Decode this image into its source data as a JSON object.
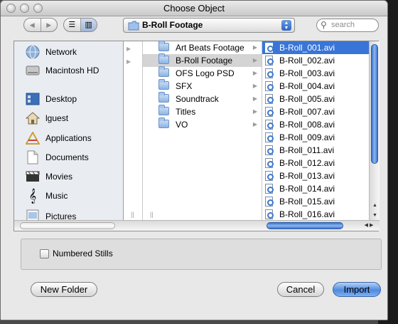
{
  "window": {
    "title": "Choose Object"
  },
  "toolbar": {
    "back_label": "◀",
    "forward_label": "▶",
    "path_label": "B-Roll Footage",
    "search_placeholder": "search"
  },
  "sidebar": {
    "items": [
      {
        "label": "Network",
        "icon": "network-icon"
      },
      {
        "label": "Macintosh HD",
        "icon": "harddisk-icon"
      },
      {
        "label": "Desktop",
        "icon": "desktop-icon"
      },
      {
        "label": "lguest",
        "icon": "home-icon"
      },
      {
        "label": "Applications",
        "icon": "applications-icon"
      },
      {
        "label": "Documents",
        "icon": "documents-icon"
      },
      {
        "label": "Movies",
        "icon": "movies-icon"
      },
      {
        "label": "Music",
        "icon": "music-icon"
      },
      {
        "label": "Pictures",
        "icon": "pictures-icon"
      }
    ]
  },
  "folders": [
    {
      "label": "Art Beats Footage"
    },
    {
      "label": "B-Roll Footage"
    },
    {
      "label": "OFS Logo PSD"
    },
    {
      "label": "SFX"
    },
    {
      "label": "Soundtrack"
    },
    {
      "label": "Titles"
    },
    {
      "label": "VO"
    }
  ],
  "files": [
    {
      "label": "B-Roll_001.avi"
    },
    {
      "label": "B-Roll_002.avi"
    },
    {
      "label": "B-Roll_003.avi"
    },
    {
      "label": "B-Roll_004.avi"
    },
    {
      "label": "B-Roll_005.avi"
    },
    {
      "label": "B-Roll_007.avi"
    },
    {
      "label": "B-Roll_008.avi"
    },
    {
      "label": "B-Roll_009.avi"
    },
    {
      "label": "B-Roll_011.avi"
    },
    {
      "label": "B-Roll_012.avi"
    },
    {
      "label": "B-Roll_013.avi"
    },
    {
      "label": "B-Roll_014.avi"
    },
    {
      "label": "B-Roll_015.avi"
    },
    {
      "label": "B-Roll_016.avi"
    }
  ],
  "options": {
    "numbered_stills_label": "Numbered Stills"
  },
  "buttons": {
    "new_folder": "New Folder",
    "cancel": "Cancel",
    "import": "Import"
  },
  "colors": {
    "selection": "#3875d7",
    "accent": "#4f8ae0"
  }
}
